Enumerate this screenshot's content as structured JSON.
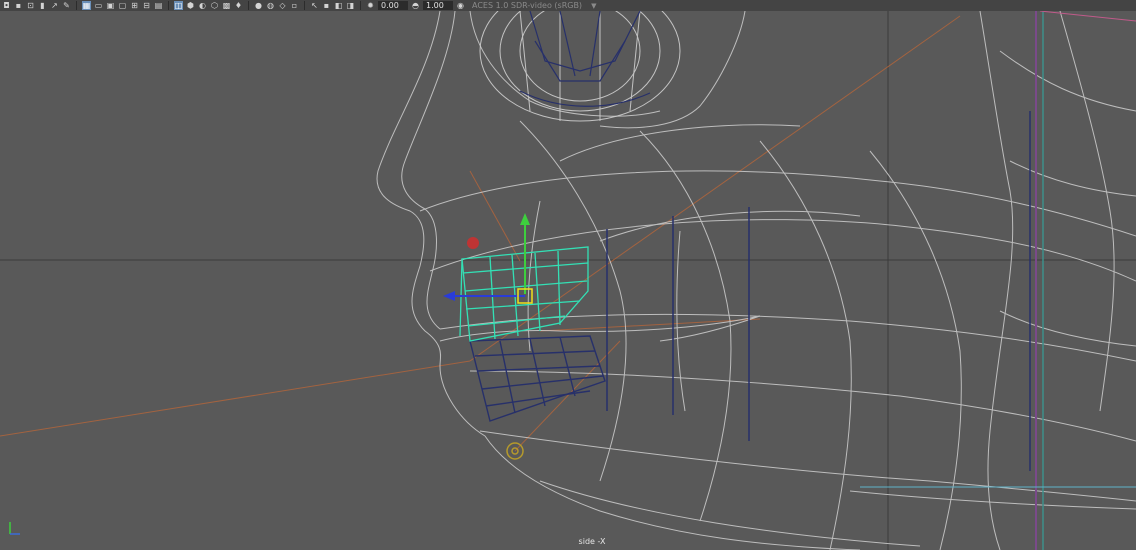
{
  "toolbar": {
    "icons_left": [
      "camera-select-icon",
      "camera-attributes-icon",
      "bookmarks-icon",
      "image-plane-icon",
      "two-d-pan-zoom-icon",
      "grease-pencil-icon",
      "grid-icon",
      "film-gate-icon",
      "resolution-gate-icon",
      "gate-mask-icon",
      "field-chart-icon",
      "safe-action-icon",
      "safe-title-icon"
    ],
    "icons_shading": [
      "wireframe-icon",
      "smooth-shade-icon",
      "wireframe-on-shaded-icon",
      "textured-icon",
      "lights-icon",
      "shadows-icon"
    ],
    "icons_mid": [
      "screen-space-ao-icon",
      "motion-blur-icon",
      "multisample-aa-icon",
      "depth-of-field-icon"
    ],
    "icons_iso": [
      "isolate-select-icon",
      "xray-icon",
      "xray-joints-icon",
      "xray-active-icon"
    ],
    "exposure_value": "0.00",
    "gamma_value": "1.00",
    "color_space": "ACES 1.0 SDR-video (sRGB)"
  },
  "viewport": {
    "camera_label": "side -X"
  }
}
